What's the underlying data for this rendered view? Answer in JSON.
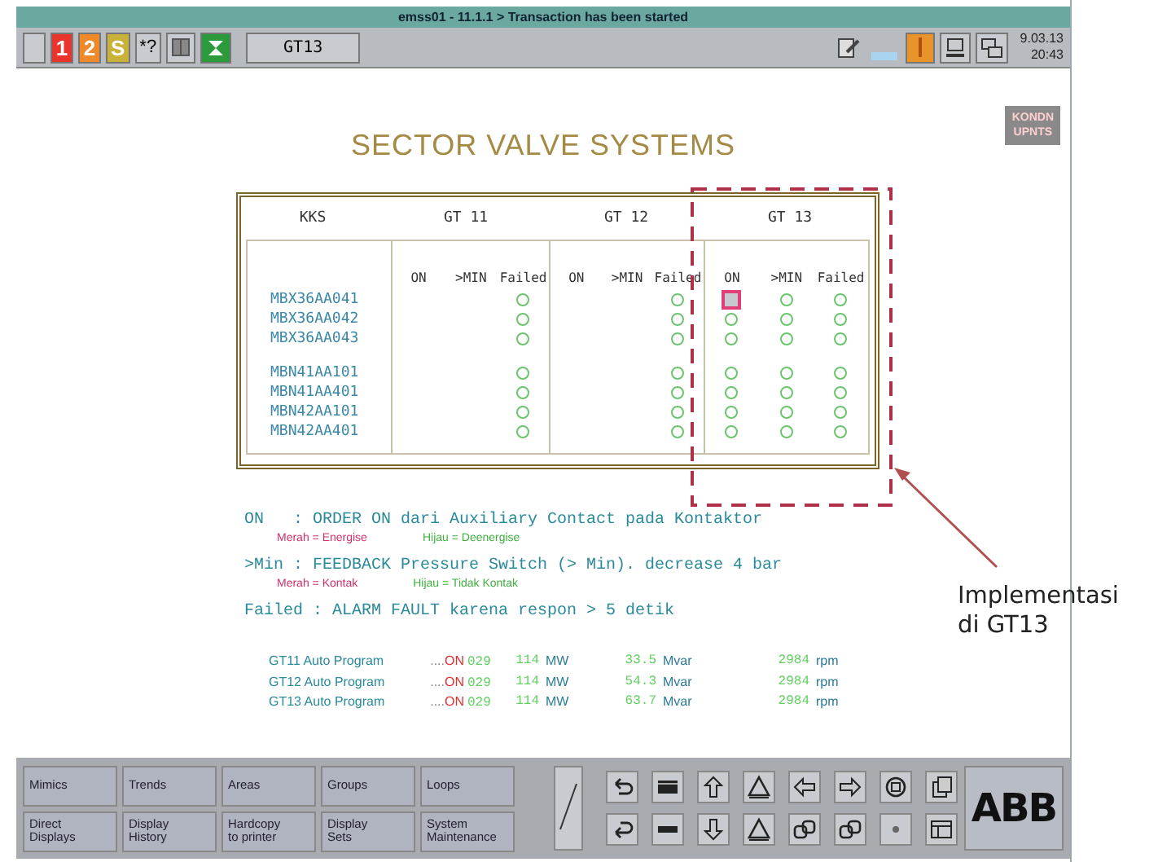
{
  "window": {
    "title": "emss01 - 11.1.1 > Transaction has been started"
  },
  "toolbar": {
    "left": [
      {
        "kind": "plain"
      },
      {
        "kind": "badge",
        "label": "1",
        "color": "#e8342a"
      },
      {
        "kind": "badge",
        "label": "2",
        "color": "#f0892a"
      },
      {
        "kind": "badge",
        "label": "S",
        "color": "#c9b23a"
      },
      {
        "kind": "text",
        "label": "*?"
      },
      {
        "kind": "grid"
      },
      {
        "kind": "green"
      },
      {
        "kind": "tab",
        "label": "GT13"
      }
    ],
    "right": [
      {
        "kind": "note"
      },
      {
        "kind": "bar"
      },
      {
        "kind": "alarm"
      },
      {
        "kind": "computer"
      },
      {
        "kind": "windows"
      }
    ],
    "date": "9.03.13",
    "time": "20:43"
  },
  "title": "SECTOR VALVE SYSTEMS",
  "corner_button": {
    "lines": [
      "KONDN",
      "UPNTS"
    ]
  },
  "table": {
    "key_header": "KKS",
    "units": [
      {
        "label": "GT 11",
        "signals": [
          "ON",
          ">MIN",
          "Failed"
        ]
      },
      {
        "label": "GT 12",
        "signals": [
          "ON",
          ">MIN",
          "Failed"
        ]
      },
      {
        "label": "GT 13",
        "signals": [
          "ON",
          ">MIN",
          "Failed"
        ]
      }
    ],
    "groups": [
      {
        "rows": [
          {
            "kks": "MBX36AA041",
            "cells": [
              {
                "kind": "none"
              },
              {
                "kind": "none"
              },
              {
                "kind": "circle"
              },
              {
                "kind": "none"
              },
              {
                "kind": "none"
              },
              {
                "kind": "circle"
              },
              {
                "kind": "square"
              },
              {
                "kind": "circle"
              },
              {
                "kind": "circle"
              }
            ]
          },
          {
            "kks": "MBX36AA042",
            "cells": [
              {
                "kind": "none"
              },
              {
                "kind": "none"
              },
              {
                "kind": "circle"
              },
              {
                "kind": "none"
              },
              {
                "kind": "none"
              },
              {
                "kind": "circle"
              },
              {
                "kind": "circle"
              },
              {
                "kind": "circle"
              },
              {
                "kind": "circle"
              }
            ]
          },
          {
            "kks": "MBX36AA043",
            "cells": [
              {
                "kind": "none"
              },
              {
                "kind": "none"
              },
              {
                "kind": "circle"
              },
              {
                "kind": "none"
              },
              {
                "kind": "none"
              },
              {
                "kind": "circle"
              },
              {
                "kind": "circle"
              },
              {
                "kind": "circle"
              },
              {
                "kind": "circle"
              }
            ]
          }
        ]
      },
      {
        "rows": [
          {
            "kks": "MBN41AA101",
            "cells": [
              {
                "kind": "none"
              },
              {
                "kind": "none"
              },
              {
                "kind": "circle"
              },
              {
                "kind": "none"
              },
              {
                "kind": "none"
              },
              {
                "kind": "circle"
              },
              {
                "kind": "circle"
              },
              {
                "kind": "circle"
              },
              {
                "kind": "circle"
              }
            ]
          },
          {
            "kks": "MBN41AA401",
            "cells": [
              {
                "kind": "none"
              },
              {
                "kind": "none"
              },
              {
                "kind": "circle"
              },
              {
                "kind": "none"
              },
              {
                "kind": "none"
              },
              {
                "kind": "circle"
              },
              {
                "kind": "circle"
              },
              {
                "kind": "circle"
              },
              {
                "kind": "circle"
              }
            ]
          },
          {
            "kks": "MBN42AA101",
            "cells": [
              {
                "kind": "none"
              },
              {
                "kind": "none"
              },
              {
                "kind": "circle"
              },
              {
                "kind": "none"
              },
              {
                "kind": "none"
              },
              {
                "kind": "circle"
              },
              {
                "kind": "circle"
              },
              {
                "kind": "circle"
              },
              {
                "kind": "circle"
              }
            ]
          },
          {
            "kks": "MBN42AA401",
            "cells": [
              {
                "kind": "none"
              },
              {
                "kind": "none"
              },
              {
                "kind": "circle"
              },
              {
                "kind": "none"
              },
              {
                "kind": "none"
              },
              {
                "kind": "circle"
              },
              {
                "kind": "circle"
              },
              {
                "kind": "circle"
              },
              {
                "kind": "circle"
              }
            ]
          }
        ]
      }
    ]
  },
  "legend": [
    {
      "text": "ON   : ORDER ON dari Auxiliary Contact pada Kontaktor",
      "red_note": "Merah = Energise",
      "green_note": "Hijau = Deenergise"
    },
    {
      "text": ">Min : FEEDBACK Pressure Switch (> Min). decrease 4 bar",
      "red_note": "Merah = Kontak",
      "green_note": "Hijau = Tidak Kontak"
    },
    {
      "text": "Failed : ALARM FAULT karena respon > 5 detik"
    }
  ],
  "programs": [
    {
      "label": "GT11 Auto Program",
      "dots": "....",
      "state": "ON",
      "code": "029",
      "power": "114",
      "power_unit": "MW",
      "reactive": "33.5",
      "reactive_unit": "Mvar",
      "speed": "2984",
      "speed_unit": "rpm"
    },
    {
      "label": "GT12 Auto Program",
      "dots": "....",
      "state": "ON",
      "code": "029",
      "power": "114",
      "power_unit": "MW",
      "reactive": "54.3",
      "reactive_unit": "Mvar",
      "speed": "2984",
      "speed_unit": "rpm"
    },
    {
      "label": "GT13 Auto Program",
      "dots": "....",
      "state": "ON",
      "code": "029",
      "power": "114",
      "power_unit": "MW",
      "reactive": "63.7",
      "reactive_unit": "Mvar",
      "speed": "2984",
      "speed_unit": "rpm"
    }
  ],
  "menu": [
    [
      "Mimics"
    ],
    [
      "Trends"
    ],
    [
      "Areas"
    ],
    [
      "Groups"
    ],
    [
      "Loops"
    ],
    [
      "Direct",
      "Displays"
    ],
    [
      "Display",
      "History"
    ],
    [
      "Hardcopy",
      "to printer"
    ],
    [
      "Display",
      "Sets"
    ],
    [
      "System",
      "Maintenance"
    ]
  ],
  "tools": [
    {
      "kind": "undo"
    },
    {
      "kind": "bar"
    },
    {
      "kind": "up"
    },
    {
      "kind": "triangle"
    },
    {
      "kind": "left"
    },
    {
      "kind": "right"
    },
    {
      "kind": "cycle"
    },
    {
      "kind": "copy"
    },
    {
      "kind": "redo"
    },
    {
      "kind": "dash"
    },
    {
      "kind": "down"
    },
    {
      "kind": "triangle"
    },
    {
      "kind": "link"
    },
    {
      "kind": "link"
    },
    {
      "kind": "dot"
    },
    {
      "kind": "window"
    }
  ],
  "logo": "ABB",
  "annotation": {
    "text": "Implementasi di GT13"
  }
}
